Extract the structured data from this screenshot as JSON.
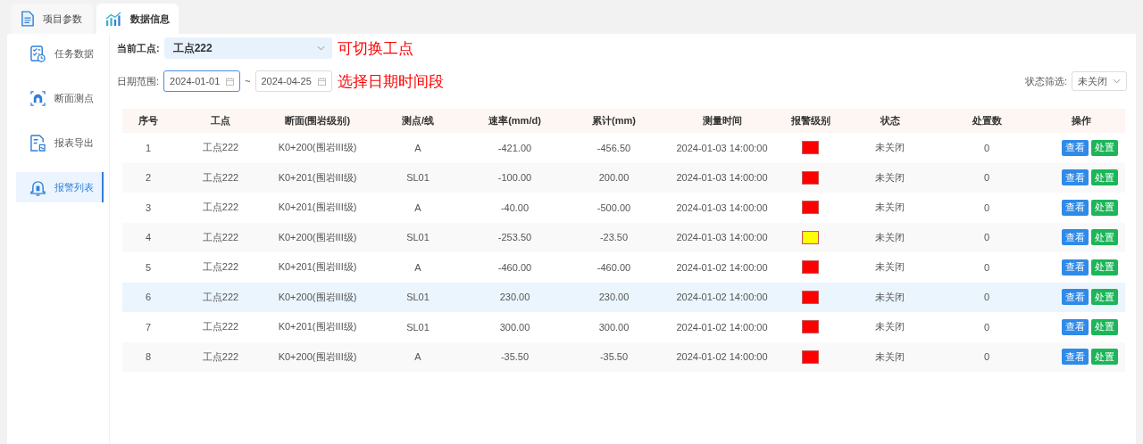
{
  "tabs": [
    {
      "label": "项目参数",
      "kind": "document",
      "selected": false
    },
    {
      "label": "数据信息",
      "kind": "chart",
      "selected": true
    }
  ],
  "sidebar": {
    "items": [
      {
        "label": "任务数据",
        "kind": "task",
        "selected": false
      },
      {
        "label": "断面测点",
        "kind": "section",
        "selected": false
      },
      {
        "label": "报表导出",
        "kind": "report",
        "selected": false
      },
      {
        "label": "报警列表",
        "kind": "alarm",
        "selected": true
      }
    ]
  },
  "filters": {
    "site_label": "当前工点:",
    "site_value": "工点222",
    "site_note": "可切换工点",
    "date_label": "日期范围:",
    "date_start": "2024-01-01",
    "date_separator": "~",
    "date_end": "2024-04-25",
    "date_note": "选择日期时间段",
    "status_label": "状态筛选:",
    "status_value": "未关闭"
  },
  "table": {
    "columns": [
      "序号",
      "工点",
      "断面(围岩级别)",
      "测点/线",
      "速率(mm/d)",
      "累计(mm)",
      "测量时间",
      "报警级别",
      "状态",
      "处置数",
      "操作"
    ],
    "rows": [
      {
        "index": "1",
        "site": "工点222",
        "section": "K0+200(围岩III级)",
        "point": "A",
        "rate": "-421.00",
        "total": "-456.50",
        "time": "2024-01-03 14:00:00",
        "color": "#ff0000",
        "status": "未关闭",
        "count": "0",
        "view": "查看",
        "handle": "处置",
        "selected": false
      },
      {
        "index": "2",
        "site": "工点222",
        "section": "K0+201(围岩III级)",
        "point": "SL01",
        "rate": "-100.00",
        "total": "200.00",
        "time": "2024-01-03 14:00:00",
        "color": "#ff0000",
        "status": "未关闭",
        "count": "0",
        "view": "查看",
        "handle": "处置",
        "selected": false
      },
      {
        "index": "3",
        "site": "工点222",
        "section": "K0+201(围岩III级)",
        "point": "A",
        "rate": "-40.00",
        "total": "-500.00",
        "time": "2024-01-03 14:00:00",
        "color": "#ff0000",
        "status": "未关闭",
        "count": "0",
        "view": "查看",
        "handle": "处置",
        "selected": false
      },
      {
        "index": "4",
        "site": "工点222",
        "section": "K0+200(围岩III级)",
        "point": "SL01",
        "rate": "-253.50",
        "total": "-23.50",
        "time": "2024-01-03 14:00:00",
        "color": "#ffff00",
        "status": "未关闭",
        "count": "0",
        "view": "查看",
        "handle": "处置",
        "selected": false
      },
      {
        "index": "5",
        "site": "工点222",
        "section": "K0+201(围岩III级)",
        "point": "A",
        "rate": "-460.00",
        "total": "-460.00",
        "time": "2024-01-02 14:00:00",
        "color": "#ff0000",
        "status": "未关闭",
        "count": "0",
        "view": "查看",
        "handle": "处置",
        "selected": false
      },
      {
        "index": "6",
        "site": "工点222",
        "section": "K0+200(围岩III级)",
        "point": "SL01",
        "rate": "230.00",
        "total": "230.00",
        "time": "2024-01-02 14:00:00",
        "color": "#ff0000",
        "status": "未关闭",
        "count": "0",
        "view": "查看",
        "handle": "处置",
        "selected": true
      },
      {
        "index": "7",
        "site": "工点222",
        "section": "K0+201(围岩III级)",
        "point": "SL01",
        "rate": "300.00",
        "total": "300.00",
        "time": "2024-01-02 14:00:00",
        "color": "#ff0000",
        "status": "未关闭",
        "count": "0",
        "view": "查看",
        "handle": "处置",
        "selected": false
      },
      {
        "index": "8",
        "site": "工点222",
        "section": "K0+200(围岩III级)",
        "point": "A",
        "rate": "-35.50",
        "total": "-35.50",
        "time": "2024-01-02 14:00:00",
        "color": "#ff0000",
        "status": "未关闭",
        "count": "0",
        "view": "查看",
        "handle": "处置",
        "selected": false
      }
    ]
  }
}
